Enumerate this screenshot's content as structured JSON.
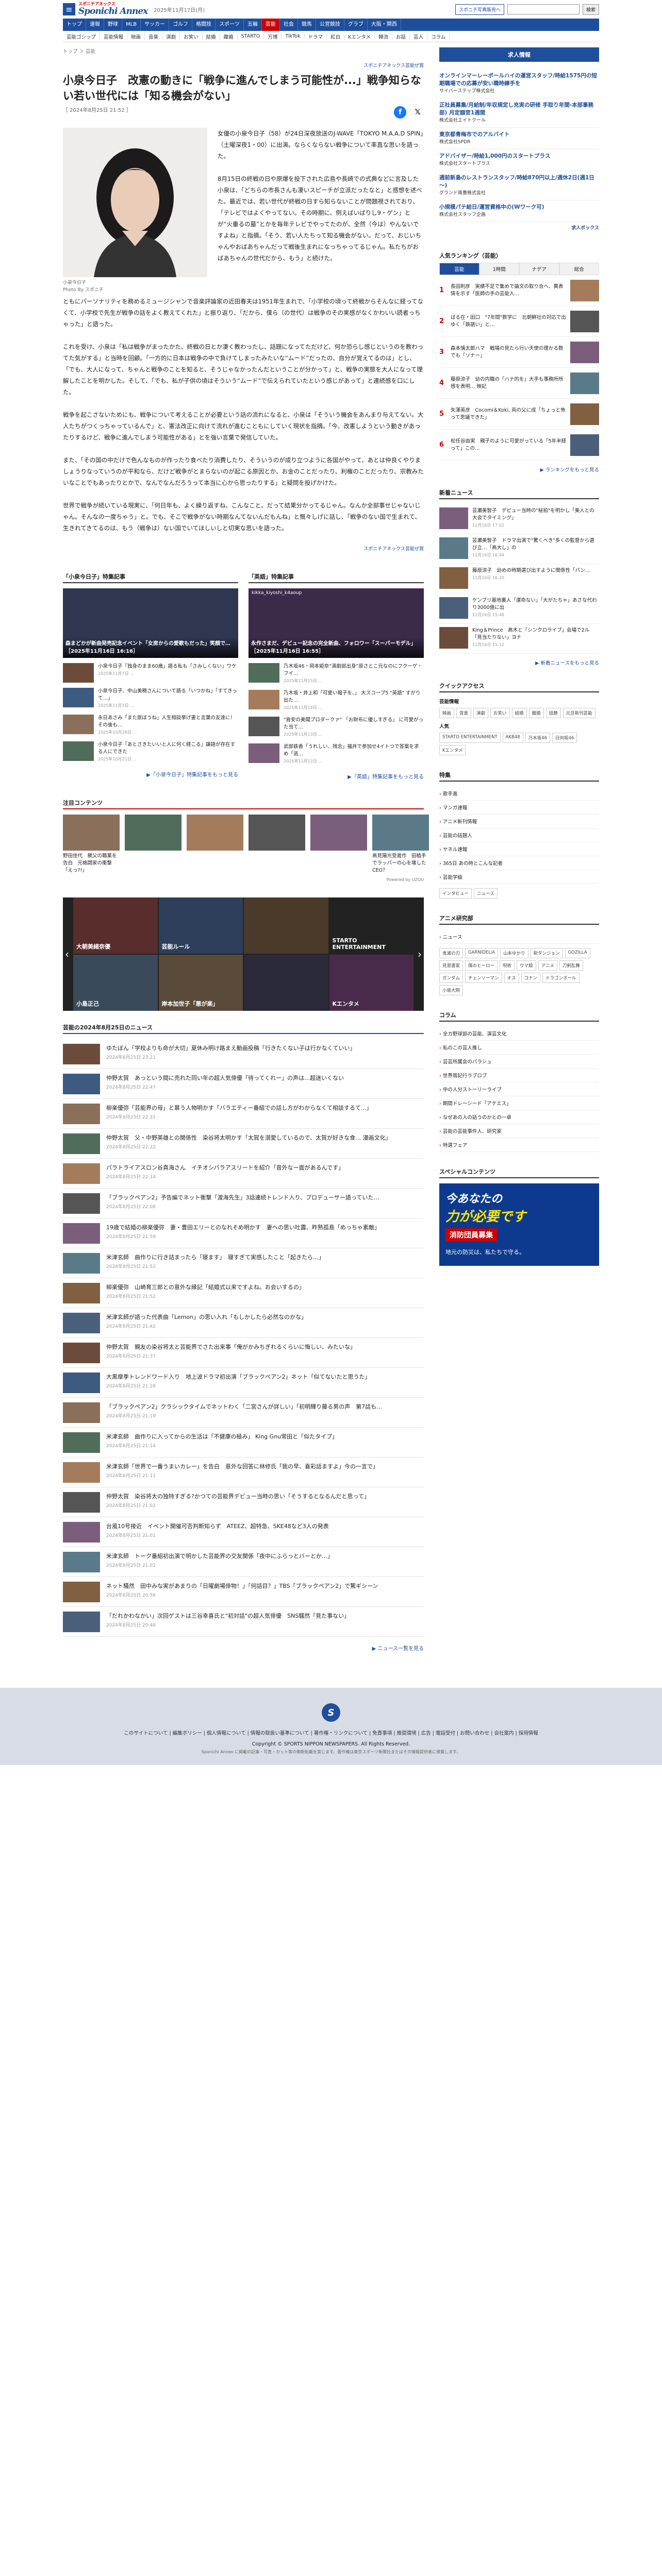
{
  "header": {
    "brand": "Sponichi Annex",
    "brand_sub": "スポニチアネックス",
    "date": "2025年11月17日(月)",
    "ad_btn": "スポニチ写真販売へ",
    "search_placeholder": "",
    "search_btn": "検索"
  },
  "gnav": [
    "トップ",
    "速報",
    "野球",
    "MLB",
    "サッカー",
    "ゴルフ",
    "格闘技",
    "スポーツ",
    "五輪",
    "芸能",
    "社会",
    "競馬",
    "公営競技",
    "グラブ",
    "大阪・関西"
  ],
  "subnav": [
    "芸能ゴシップ",
    "芸能情報",
    "映画",
    "音楽",
    "演劇",
    "お笑い",
    "結婚",
    "離婚",
    "STARTO",
    "万博",
    "TikTok",
    "ドラマ",
    "紅白",
    "Kエンタメ",
    "韓流",
    "お話",
    "芸人",
    "コラム"
  ],
  "breadcrumb": "トップ ＞ 芸能",
  "sponsor": "スポニチアネックス芸能ぜ賞",
  "title": "小泉今日子　改憲の動きに「戦争に進んでしまう可能性が...」戦争知らない若い世代には「知る機会がない」",
  "meta": "［ 2024年8月25日 21:52 ］",
  "photo_caption": "小泉今日子",
  "photo_credit": "Photo By スポニチ",
  "paragraphs": [
    "女優の小泉今日子（58）が24日深夜放送のJ-WAVE「TOKYO M.A.A.D SPIN」（土曜深夜1・00）に出演。ならくならない戦争について率直な思いを語った。",
    "8月15日の終戦の日や原爆を投下された広島や長崎での式典などに言及した小泉は、「どちらの市長さんも凄いスピーチが立派だったなと」と感想を述べた。最近では、若い世代が終戦の日すら知らないことが問題視されており、「テレビではよくやってない。その時期に、例えばいばりし9・ゲン」とが“火垂るの墓”とかを毎年テレビでやってたのが、全然（今は）やんないですよね」と指摘。「そう、若い人たちって知る機会がない。だって、おじいちゃんやおばあちゃんだって戦後生まれになっちゃってるじゃん。私たちがおばあちゃんの世代だから、もう」と続けた。",
    "ともにパーソナリティを務めるミュージシャンで音楽評論家の近田春夫は1951年生まれで、「小学校の頃って終戦からそんなに経ってなくて、小学校で先生が戦争の話をよく教えてくれた」と振り返り、「だから、僕ら（の世代）は戦争のその実感がなくかわいい読者っちゃった」と語った。",
    "これを受け、小泉は「私は戦争がまったかた、終戦の日とか凄く教わったし、話題になってただけど、何か恐らし感じというのを教わってた気がする」と当時を回顧。「一方的に日本は戦争の中で負けてしまったみたいな“ムード”だったの、自分が覚えてるのは」とし、「でも、大人になって、ちゃんと戦争のことを知ると、そうじゃなかったんだということが分かって」と、戦争の実態を大人になって理解したことを明かした。そして、「でも、私が子供の頃はそういう“ムード”で伝えられていたという感じがあって」と連続感を口にした。",
    "戦争を起こさないためにも、戦争について考えることが必要という話の流れになると、小泉は「そういう機会をあんまり与えてない。大人たちがつくっちゃっているんで」と、憲法改正に向けて流れが進むこともにしていく現状を指摘。「今、改憲しようという動きがあったりするけど、戦争に進んでしまう可能性がある」とを強い言葉で発信していた。",
    "また、「その国の中だけで色んなものが作ったり食べたり消費したり、そういうのが成り立つように各国がやって、あとは仲良くやりましょうりなっていうのが平和なら、だけど戦争がとまらないのが起こる原因とか、お金のことだったり、利権のことだったり、宗教みたいなことでもあったりとかで、なんでなんだろうって本当に心から思ったりする」と疑問を投げかけた。",
    "世界で戦争が続いている現実に、「何日年も、よく繰り返すね、こんなこと。だって結果分かってるじゃん。なんか全部事せじゃないじゃん。そんなの一度ちゃう」と。でも、そこで戦争がない時期なんてないんだもんね」と慨々しげに話し、「戦争のない国で生まれて、生きれてきてるのは、もう（戦争は）ない国でいてほしいしと切実な思いを語った。"
  ],
  "sponsor_bottom": "スポニチアネックス芸能ぜ賞",
  "feature_left": {
    "title": "「小泉今日子」特集記事",
    "hero": "森まどかが新曲発売記念イベント「女房からの愛歌もだった」笑顔で…",
    "hero_time": "［2025年11月16日 16:16］",
    "items": [
      {
        "text": "小泉今日子「独身のまま60歳」語る私も「さみしくない」ワケ",
        "time": "2025年11月7日 ..."
      },
      {
        "text": "小泉今日子、中山美穂さんについて語る「いつかね」「すてきって…」",
        "time": "2025年11月3日 ..."
      },
      {
        "text": "永日あさみ「また原ぼうね」人生相談挙げ妻と言葉の友達に！その後も…",
        "time": "2025年10月28日 ..."
      },
      {
        "text": "小泉今日子「あとさきたいいと人に何く経こる」謙語が存在する人にできた",
        "time": "2025年10月21日 ..."
      }
    ],
    "more": "▶「小泉今日子」特集記事をもっと見る"
  },
  "feature_right": {
    "title": "「英語」特集記事",
    "account": "kikka_kiyoshi_k4aoup",
    "hero": "永作さまだ、デビュー記念の完全新曲、フォロワー「スーパーモデル」",
    "hero_time": "［2025年11月16日 16:55］",
    "items": [
      {
        "text": "乃木坂46・岡本姫奈“演劇部出身”原さとこ元なのにフクーゲ・フイ…",
        "time": "2025年11月15日 ..."
      },
      {
        "text": "乃木坂・井上和「可愛い報子を、」 大スコープ5 \"英語\" すがり出た…",
        "time": "2025年11月14日 ..."
      },
      {
        "text": "\"皆安の美聞プロダークァ\" 「お財布に優しすぎる」 に可愛がった当て…",
        "time": "2025年11月13日 ..."
      },
      {
        "text": "武部鉄香「うれしい、残念」福井で参加せ4イトつで答案を求め「逃…",
        "time": "2025年11月12日 ..."
      }
    ],
    "more": "▶「英語」特集記事をもっと見る"
  },
  "recs": {
    "title": "注目コンテンツ",
    "items": [
      "野田佳代　親父の職業を告白　元格闘家の衝撃「えっ?!」",
      "",
      "",
      "",
      "",
      "高見陽光受賞作　田植手でラッパーの心を壊したCEO？"
    ],
    "powered": "Powered by UZOU"
  },
  "promo": [
    "大朝美緒奈優",
    "芸能ルール",
    "",
    "STARTO ENTERTAINMENT",
    "小島正己",
    "岸本加世子「悪が楽」",
    "",
    "Kエンタメ"
  ],
  "newslist": {
    "title": "芸能の2024年8月25日のニュース",
    "items": [
      {
        "text": "ゆたぼん「学校よりも命が大切」夏休み明け路まえ動画投稿「行きたくない子は行かなくていい」",
        "time": "2024年8月25日 23:21"
      },
      {
        "text": "仲野太賀　あっという間に売れた同い年の超人気俳優「待ってくれー」の声は…超迷いくない",
        "time": "2024年8月25日 22:47"
      },
      {
        "text": "柳楽優弥「芸能界の母」と慕う人物明かす「バラエティー番組での話し方がわからなくて相談するて...」",
        "time": "2024年8月25日 22:31"
      },
      {
        "text": "仲野太賀　父・中野英雄との関係性　染谷将太明かす「太賀を溺愛しているので、太賀が好きな食… 漫画文化」",
        "time": "2024年8月25日 22:22"
      },
      {
        "text": "パラトライアスロン谷真海さん　イチオシパラアスリートを紹介「音外なー面があるんです」",
        "time": "2024年8月25日 22:14"
      },
      {
        "text": "「ブラックペアン2」予告編でネット衝撃「渡海先生」3話連続トレンド入り、プロデューサー語っていた…",
        "time": "2024年8月25日 22:08"
      },
      {
        "text": "19歳で結婚の柳楽優弥　妻・豊田エリーとのなれそめ明かす　妻への思い吐露、昨熟孤島「めっちゃ素敵」",
        "time": "2024年8月25日 21:59"
      },
      {
        "text": "米津玄師　曲作りに行き詰まったら「寝ます」　寝すぎて実感したこと「起きたら…」",
        "time": "2024年8月25日 21:52"
      },
      {
        "text": "柳楽優弥　山崎育三郎との意外な縁記「結婚式以来ですよね。お会いするの」",
        "time": "2024年8月25日 21:52"
      },
      {
        "text": "米津玄師が語った代表曲「Lemon」の思い入れ「もしかしたら必然なのかな」",
        "time": "2024年8月25日 21:42"
      },
      {
        "text": "仲野太賀　親友の染谷将太と芸能界でさた出来事「俺がかみちぎれるくらいに悔しい、みたいな」",
        "time": "2024年8月25日 21:37"
      },
      {
        "text": "大黒摩季トレンドワード入り　地上波ドラマ初出演「ブラックペアン2」ネット「似てないたと思うた」",
        "time": "2024年8月25日 21:28"
      },
      {
        "text": "「ブラックペアン2」クラシックタイムでネットわく「二宮さんが詳しい」「初明輝り藤る男の声　第7話も…",
        "time": "2024年8月25日 21:19"
      },
      {
        "text": "米津玄師　曲作りに入ってからの生活は「不健康の極み」 King Gnu常田と「似たタイプ」",
        "time": "2024年8月25日 21:14"
      },
      {
        "text": "米津玄師「世界で一番うまいカレー」を告白　意外な回答に林修氏「我の早、喜彩話ますよ」今の一言で」",
        "time": "2024年8月25日 21:11"
      },
      {
        "text": "仲野太賀　染谷将太の独特すぎる?かつての芸能界デビュー当時の思い「そうするとなるんだと思って」",
        "time": "2024年8月25日 21:02"
      },
      {
        "text": "台風10号接近　イベント開催可否判断知らず　ATEEZ、超特急、SKE48など3人の発表",
        "time": "2024年8月25日 21:01"
      },
      {
        "text": "米津玄師　トーク番組初出演で明かした芸能界の交友関係「夜中にふらっとバーとか…」",
        "time": "2024年8月25日 21:01"
      },
      {
        "text": "ネット騒然　田中みな実があまりの「日曜劇場俳物！」「何話目？」TBS「ブラックペアン2」で驚ギシーン",
        "time": "2024年8月25日 20:56"
      },
      {
        "text": "「だれかわなかい」次回ゲストは三谷幸喜氏と\"初対話\"の超人気俳優　SNS騒然「見た事ない」",
        "time": "2024年8月25日 20:48"
      }
    ],
    "more": "▶ ニュース一覧を見る"
  },
  "side_ad": {
    "title": "求人情報",
    "items": [
      {
        "t": "オンラインマーレーボールハイの運営スタッフ/時給1575円の短期職場での応募が安い職時練手を",
        "l": "サイバーステップ株式会社"
      },
      {
        "t": "正社員募集/月給制/年収規定し充実の研修 手取り年間-本部事務部) 月定額官1週間",
        "l": "株式会社エイトクール"
      },
      {
        "t": "東京都青梅市でのアルバイト",
        "l": "株式会社SPDR"
      },
      {
        "t": "アドバイザー/時給1,000円のスタートプラス",
        "l": "株式会社スタートプラス"
      },
      {
        "t": "週前新島のレストランスタッフ/時給870円以上/週休2日(週1日～)",
        "l": "グランド南豊株式会社"
      },
      {
        "t": "小規模パテ給日/運営資格中の(Wワーク可)",
        "l": "株式会社スタッフ企画"
      }
    ],
    "label": "求人ボックス"
  },
  "ranking": {
    "title": "人気ランキング（芸能）",
    "tabs": [
      "芸能",
      "1時間",
      "ナデア",
      "総合"
    ],
    "items": [
      {
        "n": "1",
        "t": "長田則彦　実績不足で集めで論文の取り合へ、異表情を示す「医師の手の芸能人…"
      },
      {
        "n": "2",
        "t": "ばる在・田口　\"7年間\"数学に　北朝鮮社の対応で出ゆく「鉄語い」と…"
      },
      {
        "n": "3",
        "t": "森本慎太郎ハマ　戦場の見たら行い天使の理かる数でも「ソナー」"
      },
      {
        "n": "4",
        "t": "藤原涼子　幼の内職の「ハナ的を」大手も事務所所感を表明… 映記"
      },
      {
        "n": "5",
        "t": "矢澤英彦　Cocomi＆Koki, 両の父に成「ちょっと怖って思議できた」"
      },
      {
        "n": "6",
        "t": "松任谷由実　親子のように可愛がっている「5年半経って」この…"
      }
    ],
    "more": "▶ ランキングをもっと見る"
  },
  "side_news": {
    "title": "新着ニュース",
    "items": [
      {
        "t": "芸瀬美智子　デビュー当時の\"秘拍\"を明かし「美人との大会でタイミング」",
        "tm": "11月16日 17:02"
      },
      {
        "t": "芸瀬美智子　ドラマ出演で\"驚くべき\"多くの監督から選び立…「高大し」の",
        "tm": "11月16日 16:44"
      },
      {
        "t": "藤原涼子　幼めの時期選び出すように関係性「パン…",
        "tm": "11月16日 16:20"
      },
      {
        "t": "ケンブリ基地裏人「運命ない」「大がたちゃ」あさな代わり3000億に出",
        "tm": "11月16日 15:48"
      },
      {
        "t": "King＆Prince　高木と「シンクロライブ」会場で2ル「見当たりない」ヨナ",
        "tm": "11月16日 15:12"
      }
    ],
    "more": "▶ 新着ニュースをもっと見る"
  },
  "quick": {
    "title": "クイックアクセス",
    "groups": [
      {
        "g": "芸能情報",
        "tags": [
          "映画",
          "音楽",
          "演劇",
          "お笑い",
          "結婚",
          "離婚",
          "話題",
          "元旦新刊芸能"
        ]
      },
      {
        "g": "人気",
        "tags": [
          "STARTO ENTERTAINMENT",
          "AKB48",
          "乃木坂46",
          "日向坂46",
          "Kエンタメ"
        ]
      }
    ]
  },
  "special": {
    "title": "特集",
    "items": [
      "歌手進",
      "マンガ速報",
      "アニメ新刊情報",
      "芸能の話題人",
      "ヤネル速報",
      "365日 あの時とこんな記者",
      "芸能学級"
    ],
    "tags": [
      "インタビュー",
      "ニュース"
    ]
  },
  "anime": {
    "title": "アニメ研究部",
    "items": [
      "ニュース"
    ],
    "tags": [
      "鬼滅の刃",
      "GARNIDELiA",
      "山本ゆかり",
      "新ダンジョン",
      "GOZILLA",
      "見習書家",
      "僕のヒーロー",
      "呪術",
      "ウマ娘",
      "アニメ",
      "刀剣乱舞",
      "ガンダム",
      "チェンソーマン",
      "オス",
      "コナン",
      "ドラゴンボール",
      "小坂大翔"
    ]
  },
  "column": {
    "title": "コラム",
    "items": [
      "全カ野球部の芸能、演芸文化",
      "私のこの芸人推し",
      "芸芸所属会のパラシュ",
      "世界周記行ラブロブ",
      "中の人分ストーリーライブ",
      "期間ドレーシード「アテエス」",
      "なぜあの人の話うのかとの一卓",
      "芸能の芸能事件人、研究家",
      "特選フェア"
    ]
  },
  "banner": {
    "title": "スペシャルコンテンツ",
    "line1": "今あなたの",
    "line2": "力が必要です",
    "line3": "消防団員募集",
    "line4": "地元の防災は、私たちで守る。"
  },
  "footer": {
    "nav": "このサイトについて | 編集ポリシー | 個人情報について | 情報の取扱い基準について | 著作権・リンクについて | 免責事項 | 推奨環境 | 広告 | 電話受付 | お問い合わせ | 会社案内 | 採用情報",
    "copy": "Copyright © SPORTS NIPPON NEWSPAPERS. All Rights Reserved.",
    "sub": "Sponichi Annex に掲載の記事・写真・カット等の無断転載を禁じます。著作権は東京スポーツ新聞社またはその情報提供者に帰属します。"
  }
}
